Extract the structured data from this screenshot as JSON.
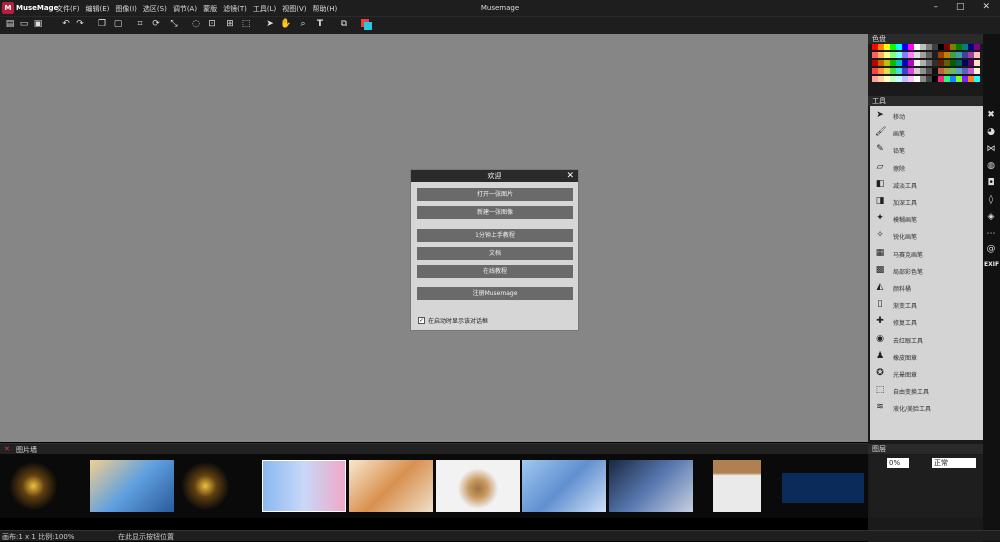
{
  "app": {
    "logo_text": "M",
    "name": "MuseMage",
    "window_title": "Musemage"
  },
  "menu": [
    "文件(F)",
    "编辑(E)",
    "图像(I)",
    "选区(S)",
    "调节(A)",
    "蒙版",
    "滤镜(T)",
    "工具(L)",
    "视图(V)",
    "帮助(H)"
  ],
  "window_buttons": {
    "minimize": "–",
    "maximize": "□",
    "close": "✕"
  },
  "toolbar_icons": [
    "new-icon",
    "open-icon",
    "save-icon",
    "undo-icon",
    "redo-icon",
    "copy-icon",
    "paste-icon",
    "crop-icon",
    "rotate-icon",
    "resize-icon",
    "select-icon",
    "transform-icon",
    "grid-icon",
    "frame-icon",
    "pointer-icon",
    "hand-icon",
    "zoom-icon",
    "text-icon",
    "layers-icon",
    "color-swap-icon"
  ],
  "dialog": {
    "title": "欢迎",
    "close": "✕",
    "buttons": [
      "打开一张图片",
      "新建一张图像",
      "1分钟上手教程",
      "文档",
      "在线教程",
      "注册Musemage"
    ],
    "checkbox_checked": true,
    "checkbox_mark": "✓",
    "checkbox_label": "在启动时显示该对话框"
  },
  "panels": {
    "palette_title": "色盘",
    "tools_title": "工具",
    "layers_title": "图层"
  },
  "palette_colors": [
    "#ff0000",
    "#ff8000",
    "#ffff00",
    "#00ff00",
    "#00ffff",
    "#0000ff",
    "#ff00ff",
    "#ffffff",
    "#c0c0c0",
    "#808080",
    "#404040",
    "#000000",
    "#800000",
    "#808000",
    "#008000",
    "#008080",
    "#000080",
    "#800080",
    "#ff6060",
    "#ffb060",
    "#ffff80",
    "#80ff80",
    "#80ffff",
    "#8080ff",
    "#ff80ff",
    "#e0e0e0",
    "#a0a0a0",
    "#606060",
    "#202020",
    "#a04000",
    "#c08000",
    "#40a040",
    "#40a0a0",
    "#4040a0",
    "#a040a0",
    "#ffc0c0",
    "#c00000",
    "#c06000",
    "#c0c000",
    "#00c000",
    "#00c0c0",
    "#0000c0",
    "#c000c0",
    "#f0f0f0",
    "#b0b0b0",
    "#707070",
    "#303030",
    "#602000",
    "#606000",
    "#006000",
    "#006060",
    "#000060",
    "#600060",
    "#ffe0c0",
    "#ff4040",
    "#ff9040",
    "#e0e040",
    "#40e040",
    "#40e0e0",
    "#4040e0",
    "#e040e0",
    "#d0d0d0",
    "#909090",
    "#505050",
    "#101010",
    "#c06040",
    "#a0a040",
    "#60c060",
    "#60a0c0",
    "#6060c0",
    "#c060c0",
    "#fff0e0",
    "#ffa0a0",
    "#ffd0a0",
    "#ffffc0",
    "#c0ffc0",
    "#c0ffff",
    "#c0c0ff",
    "#ffc0ff",
    "#ffffff",
    "#888888",
    "#444444",
    "#000000",
    "#ff2080",
    "#20ff80",
    "#2080ff",
    "#80ff20",
    "#8020ff",
    "#ff8020",
    "#20ffff"
  ],
  "tools": [
    {
      "icon": "move-icon",
      "glyph": "➤",
      "label": "移动"
    },
    {
      "icon": "brush-icon",
      "glyph": "🖌",
      "label": "画笔"
    },
    {
      "icon": "pencil-icon",
      "glyph": "✎",
      "label": "铅笔"
    },
    {
      "icon": "eraser-icon",
      "glyph": "▱",
      "label": "擦除"
    },
    {
      "icon": "dodge-icon",
      "glyph": "◧",
      "label": "减淡工具"
    },
    {
      "icon": "burn-icon",
      "glyph": "◨",
      "label": "加深工具"
    },
    {
      "icon": "blur-brush-icon",
      "glyph": "✦",
      "label": "模糊画笔"
    },
    {
      "icon": "sharpen-brush-icon",
      "glyph": "✧",
      "label": "锐化画笔"
    },
    {
      "icon": "mosaic-brush-icon",
      "glyph": "▦",
      "label": "马赛克画笔"
    },
    {
      "icon": "local-color-brush-icon",
      "glyph": "▩",
      "label": "局部彩色笔"
    },
    {
      "icon": "paint-bucket-icon",
      "glyph": "◭",
      "label": "颜料桶"
    },
    {
      "icon": "gradient-icon",
      "glyph": "▯",
      "label": "渐变工具"
    },
    {
      "icon": "repair-icon",
      "glyph": "✚",
      "label": "修复工具"
    },
    {
      "icon": "red-eye-icon",
      "glyph": "◉",
      "label": "去红眼工具"
    },
    {
      "icon": "stamp-icon",
      "glyph": "♟",
      "label": "橡皮图章"
    },
    {
      "icon": "star-stamp-icon",
      "glyph": "✪",
      "label": "光晕图章"
    },
    {
      "icon": "free-transform-icon",
      "glyph": "⬚",
      "label": "自由变换工具"
    },
    {
      "icon": "liquify-icon",
      "glyph": "≋",
      "label": "液化/美脸工具"
    }
  ],
  "side_icons": [
    "cross-tools-icon",
    "palette-icon",
    "bow-icon",
    "color-wheel-icon",
    "camera-icon",
    "drops-icon",
    "diamond-icon",
    "more-icon",
    "at-icon"
  ],
  "side_exif": "EXIF",
  "filmstrip": {
    "title": "图片墙",
    "close": "✕"
  },
  "layers": {
    "opacity": "0%",
    "blend_mode": "正常"
  },
  "status": {
    "left": "画布:1 x 1 比例:100%",
    "middle": "在此显示按钮位置"
  },
  "colors": {
    "canvas": "#868686",
    "accent": "#b2203c"
  }
}
